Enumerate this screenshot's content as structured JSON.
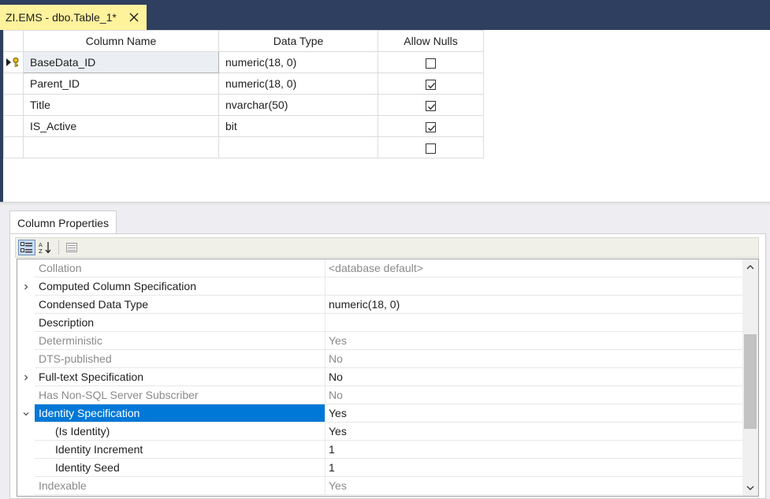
{
  "tab": {
    "title": "ZI.EMS - dbo.Table_1*"
  },
  "grid": {
    "headers": [
      "Column Name",
      "Data Type",
      "Allow Nulls"
    ],
    "rows": [
      {
        "name": "BaseData_ID",
        "type": "numeric(18, 0)",
        "allow_nulls": false,
        "primary_key": true
      },
      {
        "name": "Parent_ID",
        "type": "numeric(18, 0)",
        "allow_nulls": true
      },
      {
        "name": "Title",
        "type": "nvarchar(50)",
        "allow_nulls": true
      },
      {
        "name": "IS_Active",
        "type": "bit",
        "allow_nulls": true
      },
      {
        "name": "",
        "type": "",
        "allow_nulls": false
      }
    ]
  },
  "properties": {
    "tab_label": "Column Properties",
    "rows": [
      {
        "name": "Collation",
        "value": "<database default>",
        "readonly": true
      },
      {
        "name": "Computed Column Specification",
        "value": "",
        "expander": "collapsed"
      },
      {
        "name": "Condensed Data Type",
        "value": "numeric(18, 0)"
      },
      {
        "name": "Description",
        "value": ""
      },
      {
        "name": "Deterministic",
        "value": "Yes",
        "readonly": true
      },
      {
        "name": "DTS-published",
        "value": "No",
        "readonly": true
      },
      {
        "name": "Full-text Specification",
        "value": "No",
        "expander": "collapsed"
      },
      {
        "name": "Has Non-SQL Server Subscriber",
        "value": "No",
        "readonly": true
      },
      {
        "name": "Identity Specification",
        "value": "Yes",
        "expander": "expanded",
        "selected": true
      },
      {
        "name": "(Is Identity)",
        "value": "Yes",
        "sub": true
      },
      {
        "name": "Identity Increment",
        "value": "1",
        "sub": true
      },
      {
        "name": "Identity Seed",
        "value": "1",
        "sub": true
      },
      {
        "name": "Indexable",
        "value": "Yes",
        "readonly": true
      }
    ]
  },
  "colors": {
    "selection": "#0078d7",
    "tab_active": "#fff29d",
    "chrome": "#2f3f5f"
  }
}
